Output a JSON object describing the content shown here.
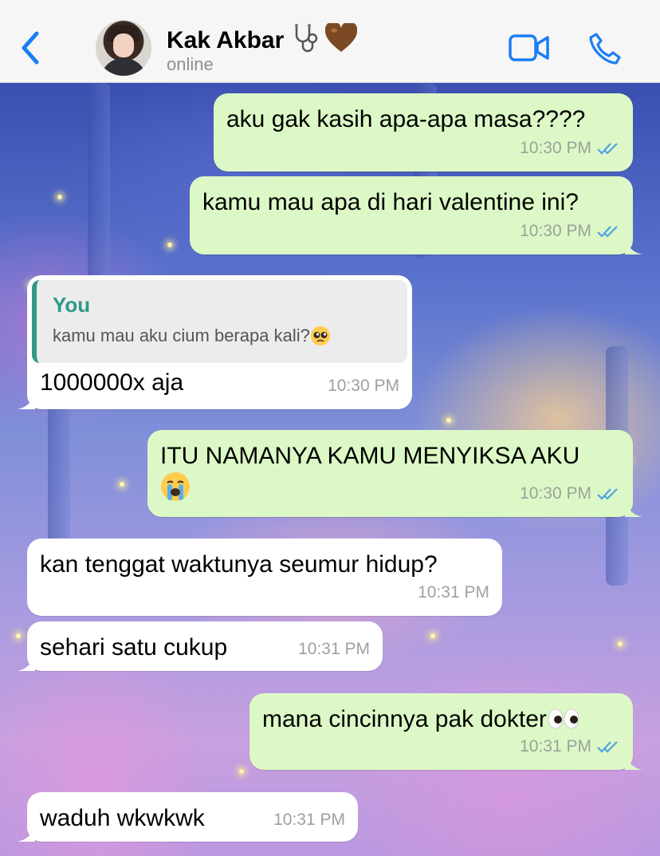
{
  "header": {
    "contact_name": "Kak Akbar",
    "status": "online",
    "accent_color": "#1a7ef4"
  },
  "messages": [
    {
      "direction": "outgoing",
      "text": "aku gak kasih apa-apa masa????",
      "time": "10:30 PM",
      "read": true
    },
    {
      "direction": "outgoing",
      "text": "kamu mau apa di hari valentine ini?",
      "time": "10:30 PM",
      "read": true
    },
    {
      "direction": "incoming",
      "quote_author": "You",
      "quote_text": "kamu mau aku cium berapa kali?",
      "text": "1000000x aja",
      "time": "10:30 PM"
    },
    {
      "direction": "outgoing",
      "text": "ITU NAMANYA KAMU MENYIKSA AKU",
      "time": "10:30 PM",
      "read": true
    },
    {
      "direction": "incoming",
      "text": "kan tenggat waktunya seumur hidup?",
      "time": "10:31 PM"
    },
    {
      "direction": "incoming",
      "text": "sehari satu cukup",
      "time": "10:31 PM"
    },
    {
      "direction": "outgoing",
      "text": "mana cincinnya pak dokter",
      "time": "10:31 PM",
      "read": true
    },
    {
      "direction": "incoming",
      "text": "waduh wkwkwk",
      "time": "10:31 PM"
    }
  ]
}
